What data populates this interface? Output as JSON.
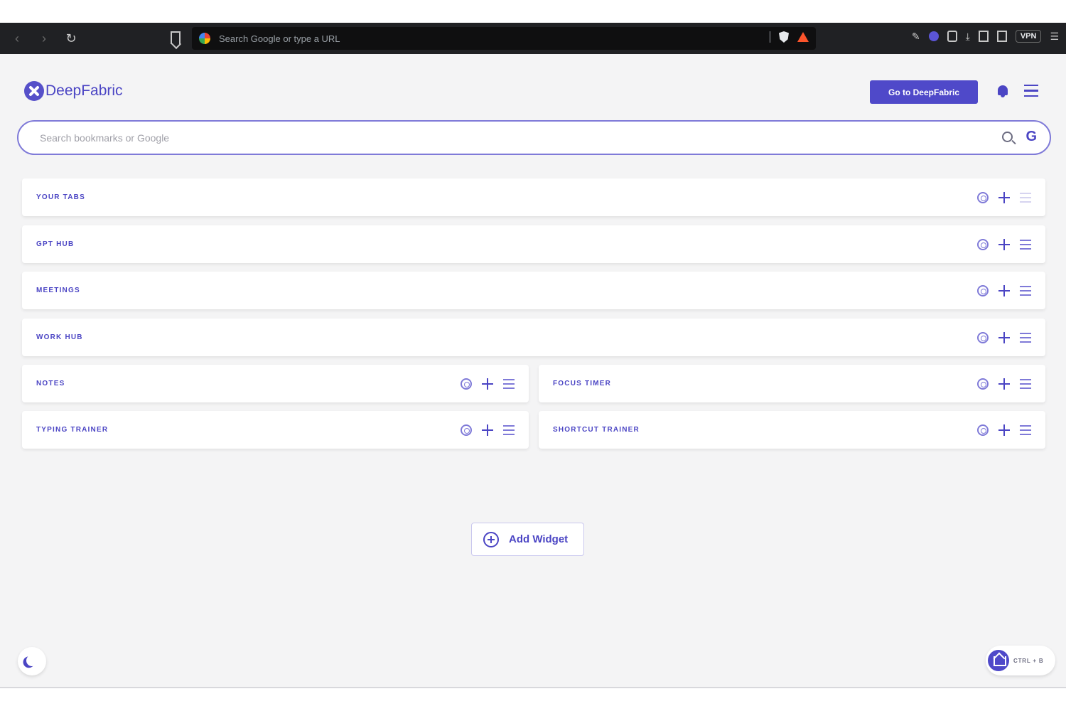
{
  "browser": {
    "omnibox_placeholder": "Search Google or type a URL",
    "vpn_label": "VPN"
  },
  "header": {
    "brand": "DeepFabric",
    "cta_label": "Go to DeepFabric"
  },
  "search": {
    "placeholder": "Search bookmarks or Google",
    "engine_glyph": "G"
  },
  "widgets": [
    {
      "title": "YOUR TABS"
    },
    {
      "title": "GPT HUB"
    },
    {
      "title": "MEETINGS"
    },
    {
      "title": "WORK HUB"
    },
    {
      "title": "NOTES"
    },
    {
      "title": "FOCUS TIMER"
    },
    {
      "title": "TYPING TRAINER"
    },
    {
      "title": "SHORTCUT TRAINER"
    }
  ],
  "add_widget_label": "Add Widget",
  "shortcut": {
    "keys": "CTRL + B"
  },
  "icons": {
    "widget_tools": [
      "settings-icon",
      "move-icon",
      "list-icon"
    ],
    "header": [
      "bell-icon",
      "menu-icon"
    ],
    "footer": [
      "moon-icon",
      "home-icon"
    ]
  },
  "colors": {
    "accent": "#4f49c9",
    "page_bg": "#f4f4f5",
    "chrome_bg": "#202124"
  }
}
